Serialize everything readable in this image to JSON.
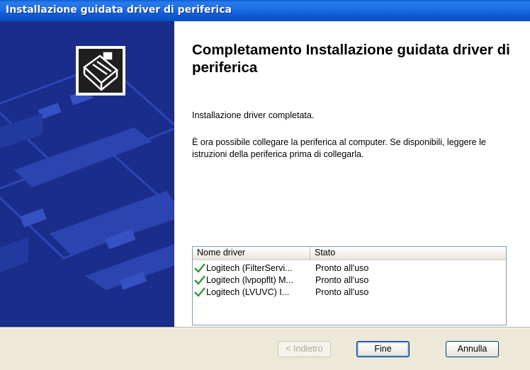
{
  "window": {
    "title": "Installazione guidata driver di periferica"
  },
  "content": {
    "heading": "Completamento Installazione guidata driver di periferica",
    "paragraph1": "Installazione driver completata.",
    "paragraph2": "È ora possibile collegare la periferica al computer. Se disponibili, leggere le istruzioni della periferica prima di collegarla."
  },
  "driver_list": {
    "columns": [
      "Nome driver",
      "Stato"
    ],
    "rows": [
      {
        "icon": "checkmark-icon",
        "name": "Logitech (FilterServi...",
        "status": "Pronto all'uso"
      },
      {
        "icon": "checkmark-icon",
        "name": "Logitech (lvpopflt) M...",
        "status": "Pronto all'uso"
      },
      {
        "icon": "checkmark-icon",
        "name": "Logitech (LVUVC) I...",
        "status": "Pronto all'uso"
      }
    ]
  },
  "buttons": {
    "back": "< Indietro",
    "finish": "Fine",
    "cancel": "Annulla"
  },
  "banner": {
    "icon": "hardware-wizard-icon"
  },
  "colors": {
    "titlebar": "#0a5fd8",
    "banner": "#1a2d8a",
    "check": "#2e9a2e",
    "dialog": "#ece9d8"
  }
}
